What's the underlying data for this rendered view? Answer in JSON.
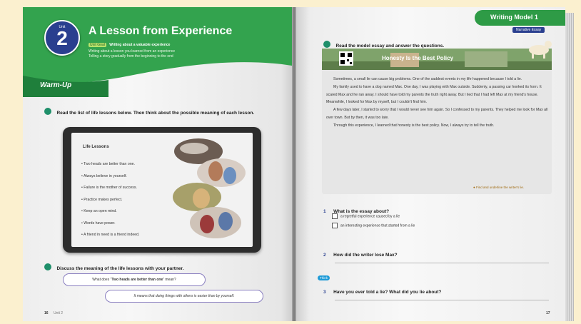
{
  "unit": {
    "badge_label": "Unit",
    "number": "2",
    "title": "A Lesson from Experience",
    "goal_tag": "Unit Goal",
    "goal_heading": "Writing about a valuable experience",
    "goal_lines": [
      "Writing about a lesson you learned from an experience",
      "Telling a story gradually from the beginning to the end"
    ]
  },
  "warmup": {
    "label": "Warm-Up",
    "instruction_a": "Read the list of life lessons below. Then think about the possible meaning of each lesson.",
    "list_title": "Life Lessons",
    "lessons": [
      "Two heads are better than one.",
      "Always believe in yourself.",
      "Failure is the mother of success.",
      "Practice makes perfect.",
      "Keep an open mind.",
      "Words have power.",
      "A friend in need is a friend indeed."
    ],
    "instruction_b": "Discuss the meaning of the life lessons with your partner.",
    "bubble1_pre": "What does \"",
    "bubble1_em": "Two heads are better than one",
    "bubble1_post": "\" mean?",
    "bubble2": "It means that doing things with others is easier than by yourself.",
    "page_number": "16",
    "footer_unit": "Unit 2"
  },
  "right": {
    "tab_title": "Writing Model 1",
    "tab_sub": "Narrative Essay",
    "instruction": "Read the model essay and answer the questions.",
    "essay_title": "Honesty Is the Best Policy",
    "paragraphs": [
      [
        "Sometimes, a small lie can cause big problems. One of the saddest events in",
        "my life happened because I told a lie."
      ],
      [
        "My family used to have a dog named Max. One day, I was playing with Max",
        "outside. Suddenly, a passing car honked its horn. It scared Max and he ran away.",
        "I should have told my parents the truth right away. But I lied that I had left Max",
        "at my friend's house. Meanwhile, I looked for Max by myself, but I couldn't find",
        "him."
      ],
      [
        "A few days later, I started to worry that I would never see him again. So I",
        "confessed to my parents. They helped me look for Max all over town. But by",
        "then, it was too late."
      ],
      [
        "Through this experience, I learned that honesty is the best policy. Now, I",
        "always try to tell the truth."
      ]
    ],
    "hint": "Find and underline the writer's lie.",
    "q1_num": "1",
    "q1": "What is the essay about?",
    "q1_options": [
      "a regretful experience caused by a lie",
      "an interesting experience that started from a lie"
    ],
    "q2_num": "2",
    "q2": "How did the writer lose Max?",
    "think_tag": "Think",
    "q3_num": "3",
    "q3": "Have you ever told a lie? What did you lie about?",
    "page_number": "17"
  },
  "colors": {
    "green": "#2e9b46",
    "dark_green": "#1a7a3a",
    "blue_badge": "#2a3f8f",
    "teal": "#1f8f6a",
    "tab_purple": "#2a3f8f"
  },
  "icons": [
    "qr-code-icon",
    "dog-illustration-icon",
    "tablet-icon",
    "checkbox-icon",
    "hint-magnifier-icon"
  ]
}
